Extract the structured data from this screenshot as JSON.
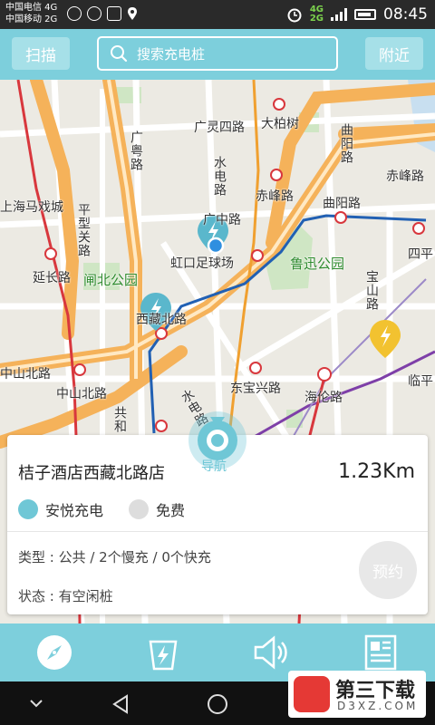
{
  "status_bar": {
    "carrier1": "中国电信 4G",
    "carrier2": "中国移动 2G",
    "network1": "4G",
    "network2": "2G",
    "time": "08:45"
  },
  "top_bar": {
    "scan_label": "扫描",
    "search_placeholder": "搜索充电桩",
    "nearby_label": "附近"
  },
  "map": {
    "labels": {
      "guanglingsi": "广灵四路",
      "dabaishu": "大柏树",
      "quyang": "曲阳路",
      "chifeng": "赤峰路",
      "chifeng2": "赤峰路",
      "quyang2": "曲阳路",
      "guangzhong": "广中路",
      "hongkou_stadium": "虹口足球场",
      "luxun_park": "鲁迅公园",
      "siping": "四平",
      "pingxing": "平型关路",
      "yanchang": "延长路",
      "zhabei_park": "闸北公园",
      "xizangbei": "西藏北路",
      "zhongshanbei": "中山北路",
      "zhongshanbei2": "中山北路",
      "dongbaoxing": "东宝兴路",
      "hailun": "海伦路",
      "linping": "临平",
      "shuidian": "水电路",
      "guangyue": "广粤路",
      "shanghai_circus": "上海马戏城",
      "shuidianlu_v": "水电路",
      "gonghe": "共和",
      "baoshan": "宝山路"
    }
  },
  "station_card": {
    "name": "桔子酒店西藏北路店",
    "distance": "1.23Km",
    "operator": "安悦充电",
    "fee": "免费",
    "type_line": "类型 : 公共 / 2个慢充 / 0个快充",
    "status_line": "状态 : 有空闲桩",
    "reserve_label": "预约",
    "navigate_label": "导航"
  },
  "bottom_nav": {
    "items": [
      "compass-icon",
      "charger-icon",
      "speaker-icon",
      "news-icon"
    ]
  },
  "watermark": {
    "title": "第三下载",
    "domain": "D3XZ.COM"
  },
  "colors": {
    "accent": "#7dcfdc",
    "marker_blue": "#5ab7cc",
    "marker_yellow": "#f2c230",
    "metro_red": "#d8373d",
    "metro_blue": "#2160b3",
    "metro_purple": "#7e3fa8",
    "road_orange": "#f5b25a"
  }
}
